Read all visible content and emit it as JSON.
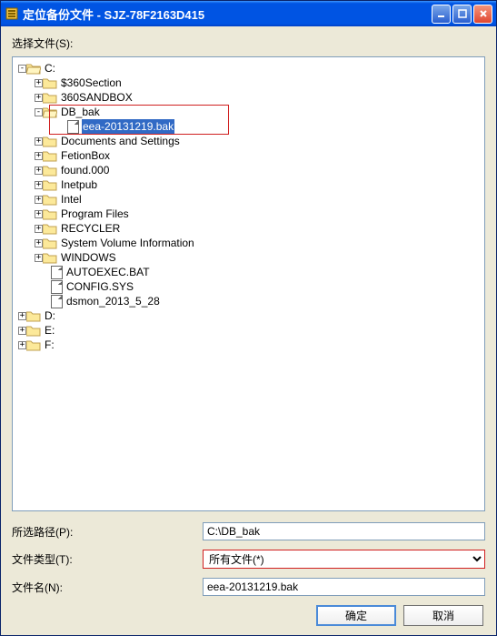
{
  "title": "定位备份文件 - SJZ-78F2163D415",
  "select_file_label": "选择文件(S):",
  "tree": {
    "c_drive": "C:",
    "folders": {
      "f360section": "$360Section",
      "f360sandbox": "360SANDBOX",
      "db_bak": "DB_bak",
      "docs": "Documents and Settings",
      "fetion": "FetionBox",
      "found": "found.000",
      "inetpub": "Inetpub",
      "intel": "Intel",
      "progfiles": "Program Files",
      "recycler": "RECYCLER",
      "sysvol": "System Volume Information",
      "windows": "WINDOWS"
    },
    "files": {
      "selected_bak": "eea-20131219.bak",
      "autoexec": "AUTOEXEC.BAT",
      "config": "CONFIG.SYS",
      "dsmon": "dsmon_2013_5_28"
    },
    "d_drive": "D:",
    "e_drive": "E:",
    "f_drive": "F:"
  },
  "path_label": "所选路径(P):",
  "path_value": "C:\\DB_bak",
  "type_label": "文件类型(T):",
  "type_value": "所有文件(*)",
  "name_label": "文件名(N):",
  "name_value": "eea-20131219.bak",
  "ok_button": "确定",
  "cancel_button": "取消"
}
